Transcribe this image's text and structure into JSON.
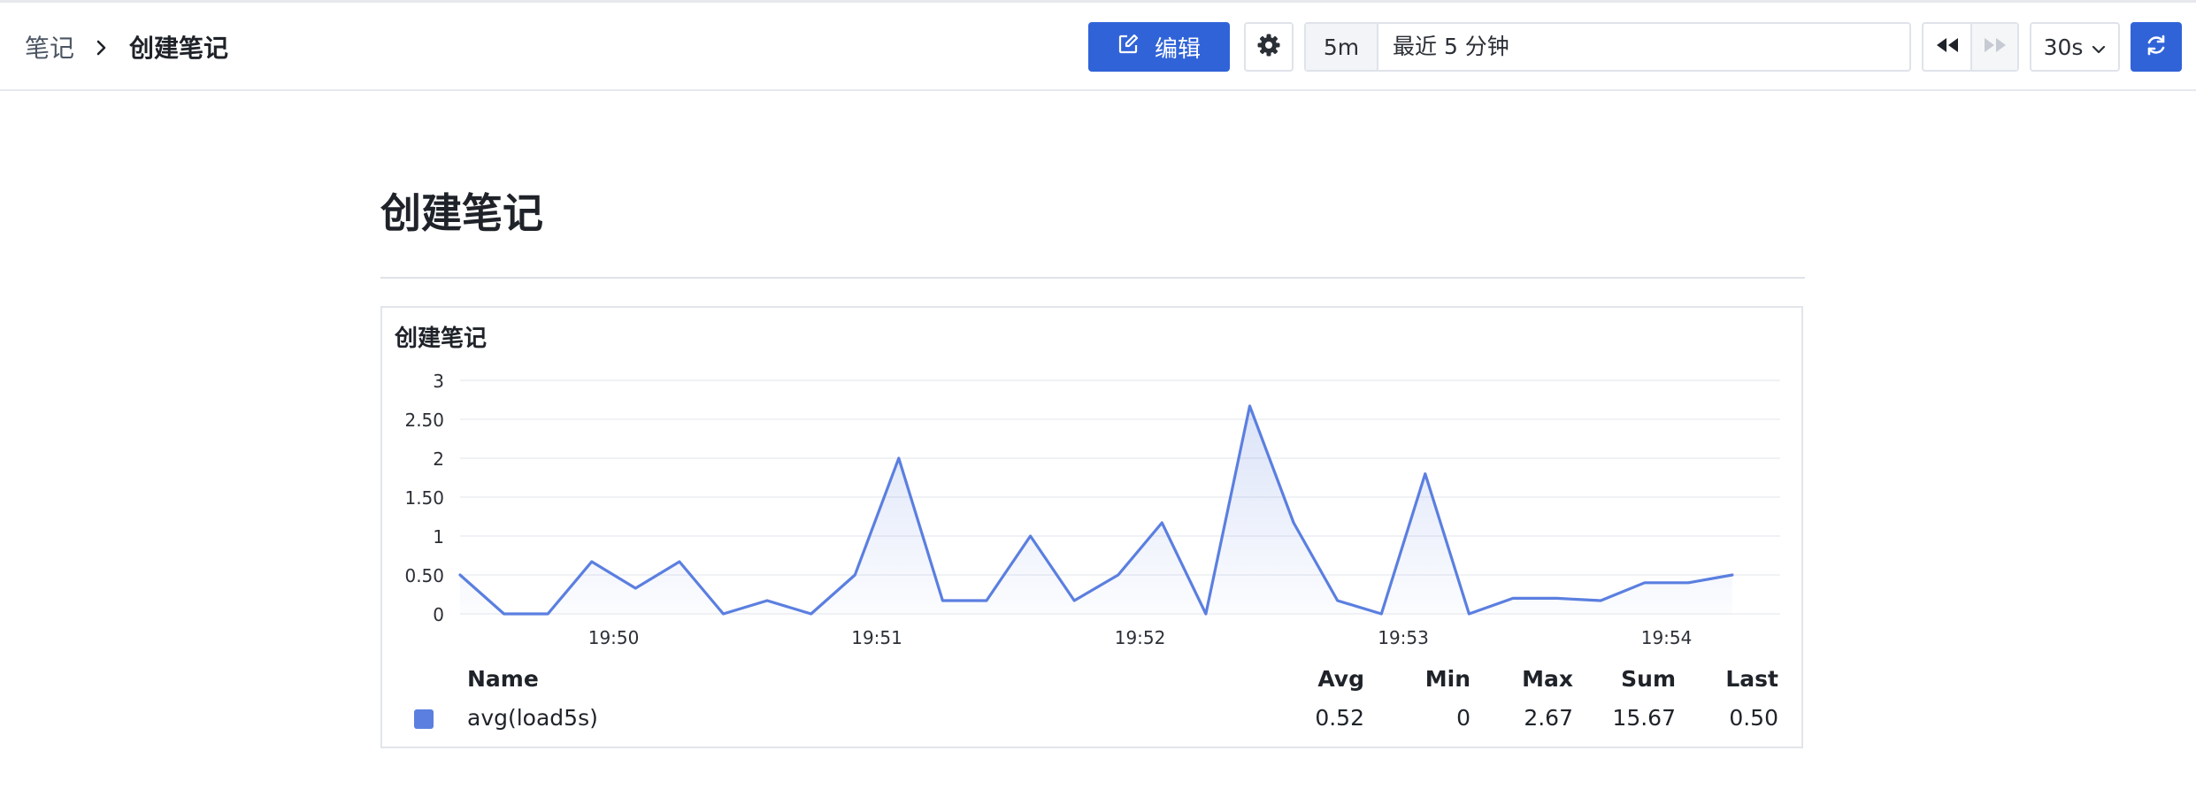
{
  "breadcrumb": {
    "root": "笔记",
    "separator": "›",
    "current": "创建笔记"
  },
  "toolbar": {
    "edit_label": "编辑",
    "range_short": "5m",
    "range_label": "最近 5 分钟",
    "interval": "30s",
    "accent": "#3163d8"
  },
  "icons": [
    "edit-icon",
    "gear-icon",
    "rewind-icon",
    "fast-forward-icon",
    "chevron-down-icon",
    "refresh-icon"
  ],
  "page": {
    "title": "创建笔记"
  },
  "panel": {
    "title": "创建笔记",
    "legend": {
      "headers": {
        "name": "Name",
        "avg": "Avg",
        "min": "Min",
        "max": "Max",
        "sum": "Sum",
        "last": "Last"
      },
      "rows": [
        {
          "name": "avg(load5s)",
          "avg": "0.52",
          "min": "0",
          "max": "2.67",
          "sum": "15.67",
          "last": "0.50",
          "color": "#5b7fe0"
        }
      ]
    }
  },
  "chart_data": {
    "type": "area",
    "title": "创建笔记",
    "xlabel": "",
    "ylabel": "",
    "ylim": [
      0,
      3
    ],
    "y_ticks": [
      "0",
      "0.50",
      "1",
      "1.50",
      "2",
      "2.50",
      "3"
    ],
    "x_ticks": [
      "19:50",
      "19:51",
      "19:52",
      "19:53",
      "19:54"
    ],
    "grid": true,
    "series": [
      {
        "name": "avg(load5s)",
        "color": "#5b7fe0",
        "x": [
          "19:49:25",
          "19:49:35",
          "19:49:45",
          "19:49:55",
          "19:50:05",
          "19:50:15",
          "19:50:25",
          "19:50:35",
          "19:50:45",
          "19:50:55",
          "19:51:05",
          "19:51:15",
          "19:51:25",
          "19:51:35",
          "19:51:45",
          "19:51:55",
          "19:52:05",
          "19:52:15",
          "19:52:25",
          "19:52:35",
          "19:52:45",
          "19:52:55",
          "19:53:05",
          "19:53:15",
          "19:53:25",
          "19:53:35",
          "19:53:45",
          "19:53:55",
          "19:54:05",
          "19:54:15"
        ],
        "values": [
          0.5,
          0,
          0,
          0.67,
          0.33,
          0.67,
          0,
          0.17,
          0,
          0.5,
          2,
          0.17,
          0.17,
          1,
          0.17,
          0.5,
          1.17,
          0,
          2.67,
          1.17,
          0.17,
          0,
          1.8,
          0,
          0.2,
          0.2,
          0.17,
          0.4,
          0.4,
          0.5
        ]
      }
    ]
  }
}
